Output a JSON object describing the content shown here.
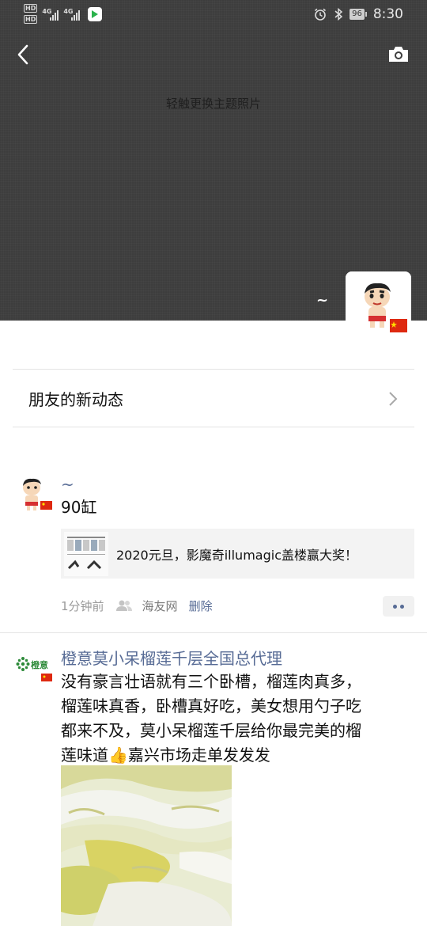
{
  "status_bar": {
    "hd_label": "HD",
    "network_1": "4G",
    "network_2": "4G",
    "battery": "96",
    "time": "8:30"
  },
  "header": {
    "cover_hint": "轻触更换主题照片",
    "nickname": "~"
  },
  "friends_updates": {
    "label": "朋友的新动态"
  },
  "posts": [
    {
      "name": "~",
      "text": "90缸",
      "link": {
        "title": "2020元旦，影魔奇illumagic盖楼赢大奖！"
      },
      "time": "1分钟前",
      "source": "海友网",
      "delete_label": "删除"
    },
    {
      "name": "橙意莫小呆榴莲千层全国总代理",
      "avatar_text": "橙意",
      "text_lines": [
        "没有豪言壮语就有三个卧槽，榴莲肉真多，",
        "榴莲味真香，卧槽真好吃，美女想用勺子吃",
        "都来不及，莫小呆榴莲千层给你最完美的榴",
        "莲味道👍嘉兴市场走单发发发"
      ]
    }
  ],
  "colors": {
    "cover_bg": "#3d3d3d",
    "link_blue": "#576b95",
    "divider": "#e4e4e4"
  }
}
